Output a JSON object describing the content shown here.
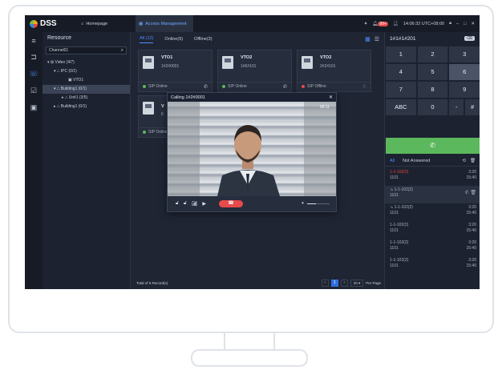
{
  "app": {
    "logo": "DSS"
  },
  "tabs": [
    {
      "label": "Homepage",
      "icon": "home-icon"
    },
    {
      "label": "Access Management",
      "icon": "grid-icon"
    }
  ],
  "titlebar": {
    "badge": "99+",
    "time": "14:06:32 UTC+08:00"
  },
  "resource": {
    "title": "Resource",
    "search": "Channel01",
    "tree": [
      {
        "label": "Video (4/7)",
        "indent": 0
      },
      {
        "label": "IPC (0/1)",
        "indent": 1
      },
      {
        "label": "VTO1",
        "indent": 2
      },
      {
        "label": "Building1 (0/1)",
        "indent": 1
      },
      {
        "label": "Unit1 (3/5)",
        "indent": 2
      },
      {
        "label": "Building1 (0/1)",
        "indent": 1
      }
    ]
  },
  "filters": [
    "All (12)",
    "Online(9)",
    "Offline(3)"
  ],
  "cards": [
    {
      "name": "VTO1",
      "number": "1#2#0001",
      "status": "SIP Online",
      "status_color": "#5cb85c"
    },
    {
      "name": "VTO2",
      "number": "1#6#101",
      "status": "SIP Online",
      "status_color": "#5cb85c"
    },
    {
      "name": "VTO2",
      "number": "2#2#101",
      "status": "SIP Offline",
      "status_color": "#e84a4a"
    },
    {
      "name": "V",
      "number": "6",
      "status": "SIP Online",
      "status_color": "#5cb85c"
    }
  ],
  "footer": {
    "total": "Total of 5 Record(s)",
    "page": "1",
    "page_size": "20",
    "per_page": "Per Page"
  },
  "call": {
    "title": "Calling 1#2#0001",
    "timer": "00:11",
    "volume": 0.4
  },
  "dial": {
    "display": "1#1#1#201",
    "keys": [
      "1",
      "2",
      "3",
      "4",
      "5",
      "6",
      "7",
      "8",
      "9",
      "ABC",
      "0",
      "-",
      "#"
    ],
    "log_tabs": [
      "All",
      "Not Answered"
    ],
    "log": [
      {
        "name": "1-1-102(2)",
        "num": "1101",
        "date": "3:20",
        "time": "15:40",
        "missed": true
      },
      {
        "name": "1-1-102(2)",
        "num": "1101",
        "date": "3:20",
        "time": "15:40",
        "missed": false
      },
      {
        "name": "1-1-102(2)",
        "num": "1101",
        "date": "3:20",
        "time": "15:40",
        "missed": false
      },
      {
        "name": "1-1-102(2)",
        "num": "1101",
        "date": "3:20",
        "time": "15:40",
        "missed": false
      },
      {
        "name": "1-1-102(2)",
        "num": "1101",
        "date": "3:20",
        "time": "15:40",
        "missed": false
      },
      {
        "name": "1-1-102(2)",
        "num": "1101",
        "date": "3:20",
        "time": "15:40",
        "missed": false
      }
    ]
  },
  "colors": {
    "accent": "#4f8fff",
    "call_green": "#5cb85c",
    "hangup_red": "#e84a4a"
  }
}
